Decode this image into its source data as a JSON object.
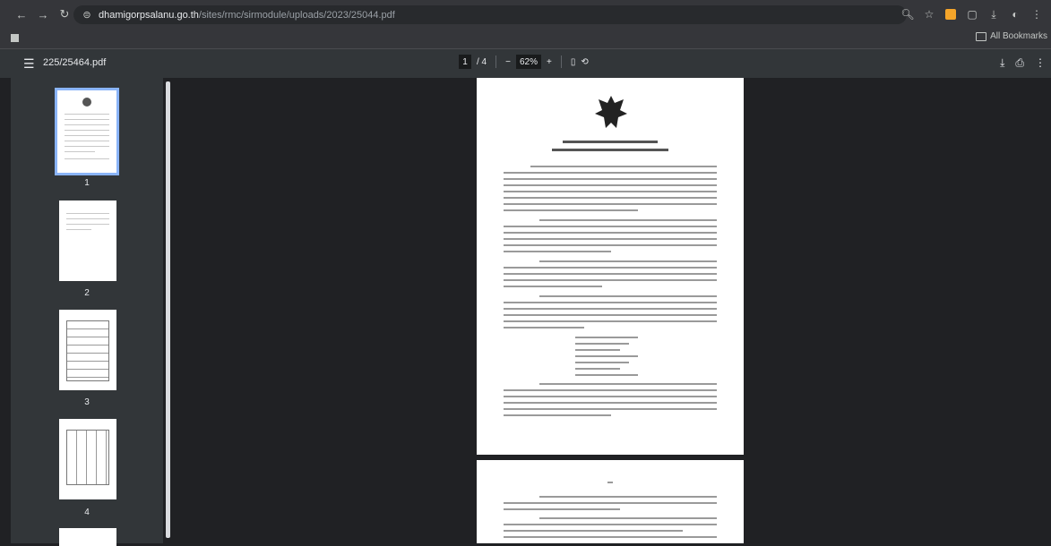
{
  "browser": {
    "url_host": "dhamigorpsalanu.go.th",
    "url_path": "/sites/rmc/sirmodule/uploads/2023/25044.pdf",
    "bookmarks_folder": "All Bookmarks"
  },
  "pdf_toolbar": {
    "file_title": "225/25464.pdf",
    "current_page": "1",
    "page_total": "/ 4",
    "zoom_minus": "−",
    "zoom_value": "62%",
    "zoom_plus": "+"
  },
  "sidebar": {
    "thumbnails": [
      {
        "label": "1"
      },
      {
        "label": "2"
      },
      {
        "label": "3"
      },
      {
        "label": "4"
      }
    ]
  },
  "colors": {
    "accent": "#8ab4f8",
    "toolbar": "#323639",
    "viewer_bg": "#202124"
  }
}
